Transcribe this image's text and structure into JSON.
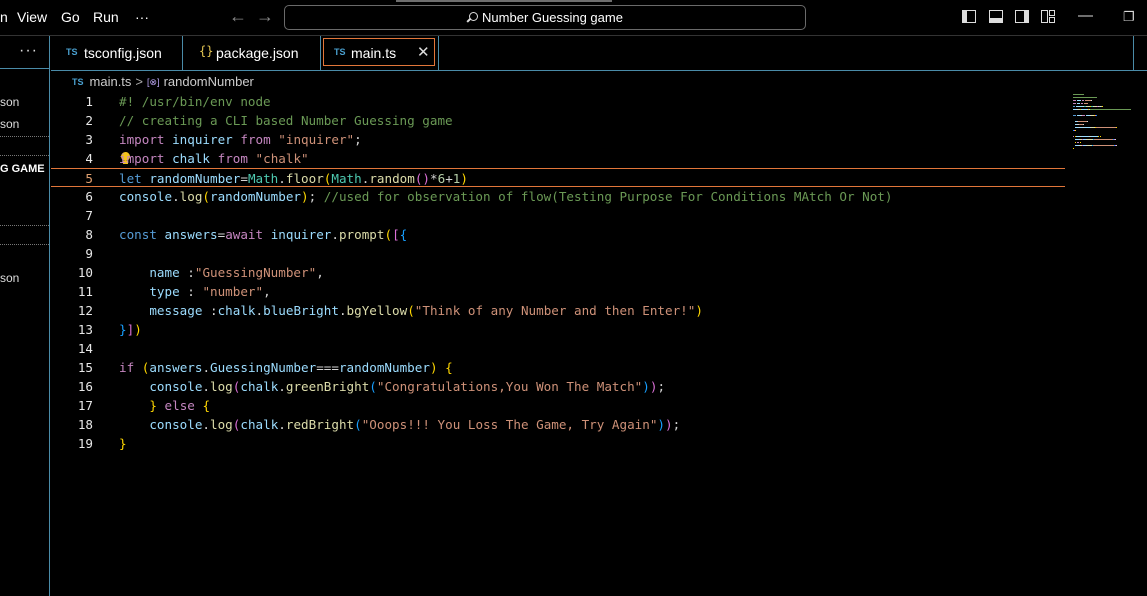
{
  "menu": {
    "partial_item": "n",
    "view": "View",
    "go": "Go",
    "run": "Run",
    "more": "···"
  },
  "search": {
    "text": "Number Guessing game"
  },
  "sidebar": {
    "more": "···",
    "items": [
      "son",
      "son",
      "G GAME",
      "son"
    ]
  },
  "tabs": [
    {
      "icon": "ts-file-icon",
      "label": "tsconfig.json"
    },
    {
      "icon": "json-file-icon",
      "label": "package.json"
    },
    {
      "icon": "ts-file-icon",
      "label": "main.ts",
      "active": true
    }
  ],
  "tab_icons": {
    "ts": "TS",
    "json": "{}",
    "close": "✕"
  },
  "breadcrumb": {
    "file_icon": "TS",
    "file": "main.ts",
    "separator": ">",
    "symbol_icon": "[⊗]",
    "symbol": "randomNumber"
  },
  "editor": {
    "current_line": 5,
    "lines": [
      [
        [
          "#! /usr/bin/env node",
          "comment"
        ]
      ],
      [
        [
          "// creating a CLI based Number Guessing game",
          "comment"
        ]
      ],
      [
        [
          "import",
          "ctrl"
        ],
        [
          " ",
          "op"
        ],
        [
          "inquirer",
          "var"
        ],
        [
          " ",
          "op"
        ],
        [
          "from",
          "ctrl"
        ],
        [
          " ",
          "op"
        ],
        [
          "\"inquirer\"",
          "str"
        ],
        [
          ";",
          "op"
        ]
      ],
      [
        [
          "import",
          "ctrl"
        ],
        [
          " ",
          "op"
        ],
        [
          "chalk",
          "var"
        ],
        [
          " ",
          "op"
        ],
        [
          "from",
          "ctrl"
        ],
        [
          " ",
          "op"
        ],
        [
          "\"chalk\"",
          "str"
        ]
      ],
      [
        [
          "let",
          "kw"
        ],
        [
          " ",
          "op"
        ],
        [
          "randomNumber",
          "var"
        ],
        [
          "=",
          "op"
        ],
        [
          "Math",
          "cls"
        ],
        [
          ".",
          "op"
        ],
        [
          "floor",
          "fn"
        ],
        [
          "(",
          "b1"
        ],
        [
          "Math",
          "cls"
        ],
        [
          ".",
          "op"
        ],
        [
          "random",
          "fn"
        ],
        [
          "()",
          "b2"
        ],
        [
          "*",
          "op"
        ],
        [
          "6",
          "num"
        ],
        [
          "+",
          "op"
        ],
        [
          "1",
          "num"
        ],
        [
          ")",
          "b1"
        ]
      ],
      [
        [
          "console",
          "var"
        ],
        [
          ".",
          "op"
        ],
        [
          "log",
          "fn"
        ],
        [
          "(",
          "b1"
        ],
        [
          "randomNumber",
          "var"
        ],
        [
          ")",
          "b1"
        ],
        [
          "; ",
          "op"
        ],
        [
          "//used for observation of flow(Testing Purpose For Conditions MAtch Or Not)",
          "comment"
        ]
      ],
      [],
      [
        [
          "const",
          "kw"
        ],
        [
          " ",
          "op"
        ],
        [
          "answers",
          "var"
        ],
        [
          "=",
          "op"
        ],
        [
          "await",
          "ctrl"
        ],
        [
          " ",
          "op"
        ],
        [
          "inquirer",
          "var"
        ],
        [
          ".",
          "op"
        ],
        [
          "prompt",
          "fn"
        ],
        [
          "(",
          "b1"
        ],
        [
          "[",
          "b2"
        ],
        [
          "{",
          "b3"
        ]
      ],
      [],
      [
        [
          "    ",
          "op"
        ],
        [
          "name",
          "var"
        ],
        [
          " :",
          "op"
        ],
        [
          "\"GuessingNumber\"",
          "str"
        ],
        [
          ",",
          "op"
        ]
      ],
      [
        [
          "    ",
          "op"
        ],
        [
          "type",
          "var"
        ],
        [
          " : ",
          "op"
        ],
        [
          "\"number\"",
          "str"
        ],
        [
          ",",
          "op"
        ]
      ],
      [
        [
          "    ",
          "op"
        ],
        [
          "message",
          "var"
        ],
        [
          " :",
          "op"
        ],
        [
          "chalk",
          "var"
        ],
        [
          ".",
          "op"
        ],
        [
          "blueBright",
          "var"
        ],
        [
          ".",
          "op"
        ],
        [
          "bgYellow",
          "fn"
        ],
        [
          "(",
          "b1"
        ],
        [
          "\"Think of any Number and then Enter!\"",
          "str"
        ],
        [
          ")",
          "b1"
        ]
      ],
      [
        [
          "}",
          "b3"
        ],
        [
          "]",
          "b2"
        ],
        [
          ")",
          "b1"
        ]
      ],
      [],
      [
        [
          "if",
          "ctrl"
        ],
        [
          " ",
          "op"
        ],
        [
          "(",
          "b1"
        ],
        [
          "answers",
          "var"
        ],
        [
          ".",
          "op"
        ],
        [
          "GuessingNumber",
          "var"
        ],
        [
          "===",
          "op"
        ],
        [
          "randomNumber",
          "var"
        ],
        [
          ")",
          "b1"
        ],
        [
          " ",
          "op"
        ],
        [
          "{",
          "b1"
        ]
      ],
      [
        [
          "    ",
          "op"
        ],
        [
          "console",
          "var"
        ],
        [
          ".",
          "op"
        ],
        [
          "log",
          "fn"
        ],
        [
          "(",
          "b2"
        ],
        [
          "chalk",
          "var"
        ],
        [
          ".",
          "op"
        ],
        [
          "greenBright",
          "fn"
        ],
        [
          "(",
          "b3"
        ],
        [
          "\"Congratulations,You Won The Match\"",
          "str"
        ],
        [
          ")",
          "b3"
        ],
        [
          ")",
          "b2"
        ],
        [
          ";",
          "op"
        ]
      ],
      [
        [
          "    ",
          "op"
        ],
        [
          "}",
          "b1"
        ],
        [
          " ",
          "op"
        ],
        [
          "else",
          "ctrl"
        ],
        [
          " ",
          "op"
        ],
        [
          "{",
          "b1"
        ]
      ],
      [
        [
          "    ",
          "op"
        ],
        [
          "console",
          "var"
        ],
        [
          ".",
          "op"
        ],
        [
          "log",
          "fn"
        ],
        [
          "(",
          "b2"
        ],
        [
          "chalk",
          "var"
        ],
        [
          ".",
          "op"
        ],
        [
          "redBright",
          "fn"
        ],
        [
          "(",
          "b3"
        ],
        [
          "\"Ooops!!! You Loss The Game, Try Again\"",
          "str"
        ],
        [
          ")",
          "b3"
        ],
        [
          ")",
          "b2"
        ],
        [
          ";",
          "op"
        ]
      ],
      [
        [
          "}",
          "b1"
        ]
      ]
    ]
  },
  "colors": {
    "accent_border": "#4a8ba8",
    "active_tab_border": "#e1763a",
    "background": "#000000"
  }
}
